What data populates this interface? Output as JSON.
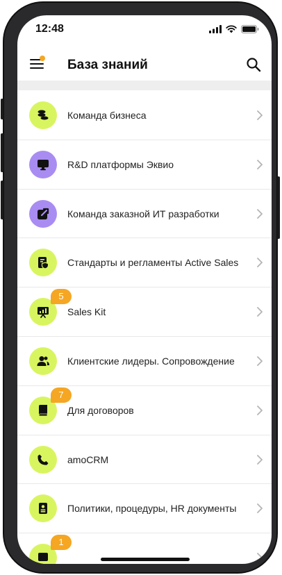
{
  "status_bar": {
    "time": "12:48"
  },
  "header": {
    "title": "База знаний"
  },
  "colors": {
    "lime": "#d8f560",
    "purple": "#a98cf2",
    "badge": "#f5a623"
  },
  "items": [
    {
      "label": "Команда бизнеса",
      "icon": "coins-icon",
      "color": "lime",
      "badge": null
    },
    {
      "label": "R&D платформы Эквио",
      "icon": "monitor-icon",
      "color": "purple",
      "badge": null
    },
    {
      "label": "Команда заказной ИТ разработки",
      "icon": "external-link-icon",
      "color": "purple",
      "badge": null
    },
    {
      "label": "Стандарты и регламенты Active Sales",
      "icon": "document-shield-icon",
      "color": "lime",
      "badge": null
    },
    {
      "label": "Sales Kit",
      "icon": "presentation-icon",
      "color": "lime",
      "badge": "5"
    },
    {
      "label": "Клиентские лидеры. Сопровождение",
      "icon": "users-icon",
      "color": "lime",
      "badge": null
    },
    {
      "label": "Для договоров",
      "icon": "book-icon",
      "color": "lime",
      "badge": "7"
    },
    {
      "label": "amoCRM",
      "icon": "phone-icon",
      "color": "lime",
      "badge": null
    },
    {
      "label": "Политики, процедуры, HR документы",
      "icon": "id-card-icon",
      "color": "lime",
      "badge": null
    },
    {
      "label": "",
      "icon": "folder-icon",
      "color": "lime",
      "badge": "1"
    }
  ]
}
